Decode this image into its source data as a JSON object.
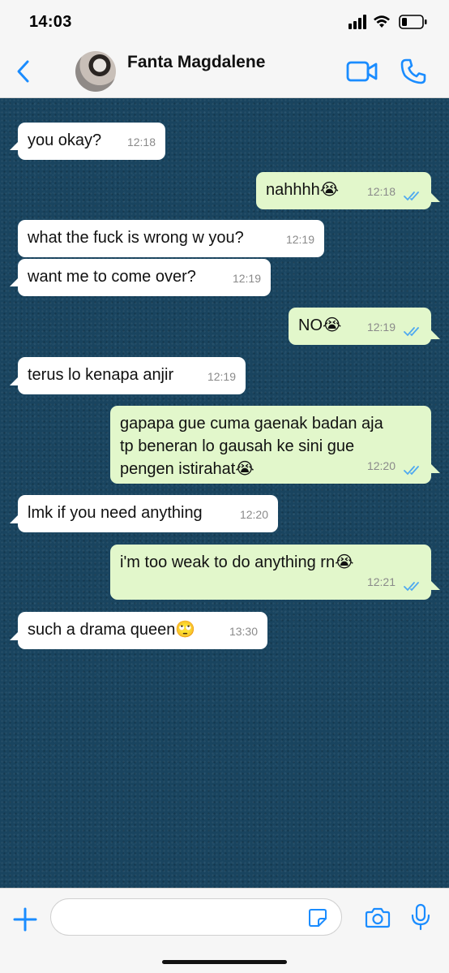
{
  "status_bar": {
    "time": "14:03"
  },
  "header": {
    "contact_name": "Fanta Magdalene"
  },
  "messages": [
    {
      "direction": "in",
      "text": "you okay?",
      "time": "12:18"
    },
    {
      "direction": "out",
      "text": "nahhhh😭",
      "time": "12:18"
    },
    {
      "direction": "in",
      "text": "what the fuck is wrong w you?",
      "time": "12:19"
    },
    {
      "direction": "in",
      "text": "want me to come over?",
      "time": "12:19"
    },
    {
      "direction": "out",
      "text": "NO😭",
      "time": "12:19"
    },
    {
      "direction": "in",
      "text": "terus lo kenapa anjir",
      "time": "12:19"
    },
    {
      "direction": "out",
      "text": "gapapa gue cuma gaenak badan aja\ntp beneran lo gausah ke sini gue\npengen istirahat😭",
      "time": "12:20"
    },
    {
      "direction": "in",
      "text": "lmk if you need anything",
      "time": "12:20"
    },
    {
      "direction": "out",
      "text": "i'm too weak to do anything rn😭",
      "time": "12:21"
    },
    {
      "direction": "in",
      "text": "such a drama queen🙄",
      "time": "13:30"
    }
  ],
  "input": {
    "placeholder": ""
  },
  "colors": {
    "accent": "#1a8cff",
    "chat_background": "#19445f",
    "incoming_bubble": "#ffffff",
    "outgoing_bubble": "#e2f7cb",
    "read_ticks": "#4fa9f0"
  },
  "icons": {
    "back": "chevron-left-icon",
    "video": "video-camera-icon",
    "call": "phone-icon",
    "plus": "plus-icon",
    "sticker": "sticker-icon",
    "camera": "camera-icon",
    "mic": "microphone-icon",
    "read": "double-check-icon"
  }
}
